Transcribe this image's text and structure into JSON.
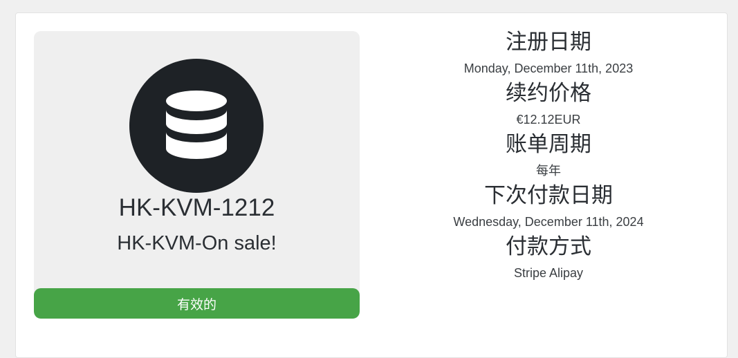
{
  "product": {
    "name": "HK-KVM-1212",
    "description": "HK-KVM-On sale!",
    "status": "有效的",
    "icon": "database-icon",
    "status_color": "#47a447",
    "icon_bg_color": "#1e2226"
  },
  "details": [
    {
      "label": "注册日期",
      "value": "Monday, December 11th, 2023"
    },
    {
      "label": "续约价格",
      "value": "€12.12EUR"
    },
    {
      "label": "账单周期",
      "value": "每年"
    },
    {
      "label": "下次付款日期",
      "value": "Wednesday, December 11th, 2024"
    },
    {
      "label": "付款方式",
      "value": "Stripe Alipay"
    }
  ]
}
